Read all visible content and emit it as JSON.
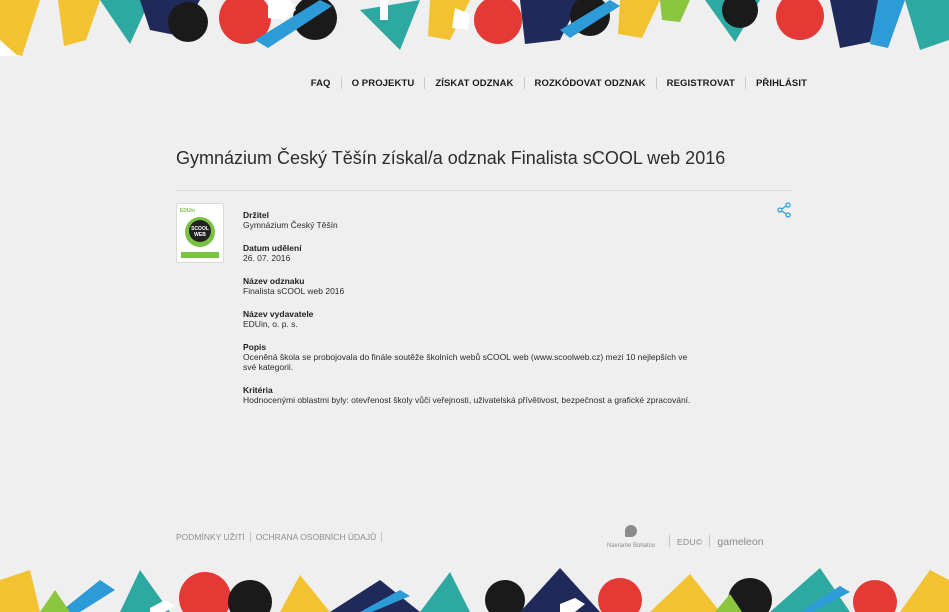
{
  "nav": {
    "items": [
      "FAQ",
      "O PROJEKTU",
      "ZÍSKAT ODZNAK",
      "ROZKÓDOVAT ODZNAK",
      "REGISTROVAT",
      "PŘIHLÁSIT"
    ]
  },
  "page": {
    "title": "Gymnázium Český Těšín získal/a odznak Finalista sCOOL web 2016"
  },
  "badge": {
    "brand": "EDUin",
    "line1": "SCOOL",
    "line2": "WEB"
  },
  "details": {
    "fields": [
      {
        "label": "Držitel",
        "value": "Gymnázium Český Těšín"
      },
      {
        "label": "Datum udělení",
        "value": "26. 07. 2016"
      },
      {
        "label": "Název odznaku",
        "value": "Finalista sCOOL web 2016"
      },
      {
        "label": "Název vydavatele",
        "value": "EDUin, o. p. s."
      },
      {
        "label": "Popis",
        "value": "Oceněná škola se probojovala do finále soutěže školních webů sCOOL web (www.scoolweb.cz) mezi 10 nejlepších ve své kategorii."
      },
      {
        "label": "Kritéria",
        "value": "Hodnocenými oblastmi byly: otevřenost školy vůči veřejnosti, uživatelská přívětivost, bezpečnost a grafické zpracování."
      }
    ]
  },
  "footer": {
    "links": [
      "PODMÍNKY UŽITÍ",
      "OCHRANA OSOBNÍCH ÚDAJŮ"
    ],
    "partners": [
      "Navrame Bohatce",
      "EDU©",
      "gameleon"
    ]
  },
  "colors": {
    "background": "#efefef",
    "badge_green": "#7cc242",
    "badge_dark": "#222222",
    "banner": [
      "#e53935",
      "#1f2a5a",
      "#f2c230",
      "#2ea9a1",
      "#2c9bd8",
      "#1a1a1a",
      "#ffffff",
      "#8cc63f"
    ]
  },
  "icons": {
    "share": "share-icon"
  }
}
